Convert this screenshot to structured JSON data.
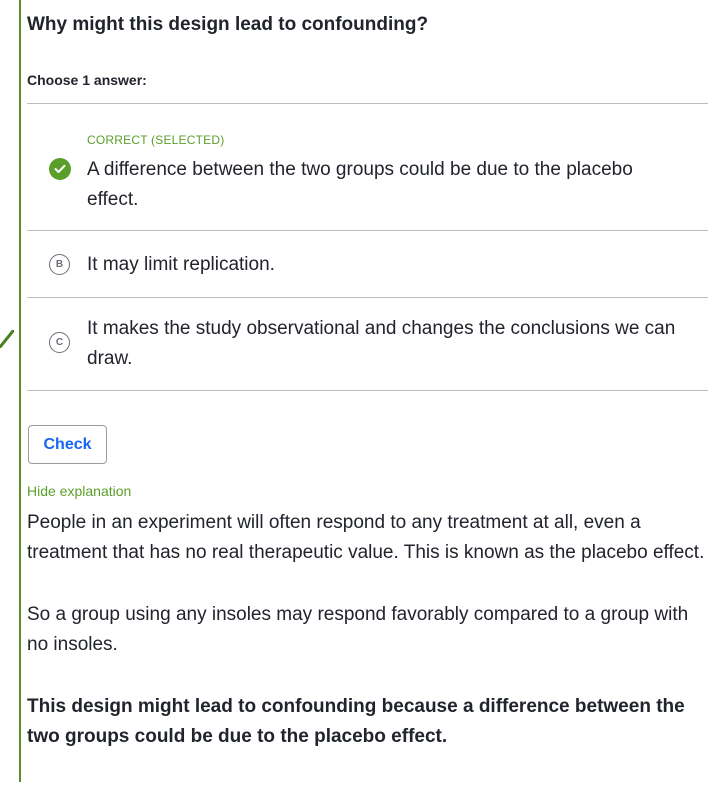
{
  "question": "Why might this design lead to confounding?",
  "prompt": "Choose 1 answer:",
  "choices": [
    {
      "letter": "A",
      "status": "CORRECT (SELECTED)",
      "text": "A difference between the two groups could be due to the placebo effect."
    },
    {
      "letter": "B",
      "text": "It may limit replication."
    },
    {
      "letter": "C",
      "text": "It makes the study observational and changes the conclusions we can draw."
    }
  ],
  "check_button": "Check",
  "hide_explanation": "Hide explanation",
  "explanation": {
    "p1": "People in an experiment will often respond to any treatment at all, even a treatment that has no real therapeutic value. This is known as the placebo effect.",
    "p2": "So a group using any insoles may respond favorably compared to a group with no insoles.",
    "p3": "This design might lead to confounding because a difference between the two groups could be due to the placebo effect."
  },
  "colors": {
    "correct": "#5a9f2a",
    "link": "#1865f2",
    "rule": "#5a8f2a"
  },
  "icons": {
    "correct_bubble": "checkmark-icon",
    "margin_mark": "checkmark-icon"
  }
}
